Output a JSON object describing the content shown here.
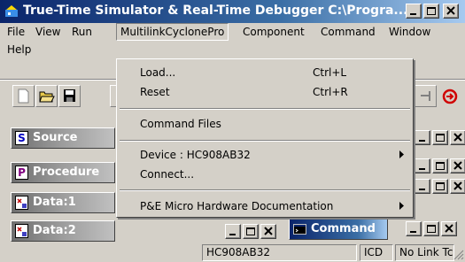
{
  "window": {
    "title": "True-Time Simulator & Real-Time Debugger  C:\\Progra..."
  },
  "menubar": {
    "items": [
      "File",
      "View",
      "Run",
      "MultilinkCyclonePro",
      "Component",
      "Command",
      "Window",
      "Help"
    ]
  },
  "dropdown": {
    "load": {
      "label": "Load...",
      "shortcut": "Ctrl+L"
    },
    "reset": {
      "label": "Reset",
      "shortcut": "Ctrl+R"
    },
    "command_files": {
      "label": "Command Files"
    },
    "device": {
      "label": "Device : HC908AB32"
    },
    "connect": {
      "label": "Connect..."
    },
    "pe_docs": {
      "label": "P&E Micro Hardware Documentation"
    }
  },
  "panels": {
    "source": {
      "title": "Source",
      "icon": "S"
    },
    "procedure": {
      "title": "Procedure",
      "icon": "P"
    },
    "data1": {
      "title": "Data:1"
    },
    "data2": {
      "title": "Data:2"
    },
    "command": {
      "title": "Command"
    }
  },
  "statusbar": {
    "device": "HC908AB32",
    "mode": "ICD",
    "link": "No Link Tc"
  },
  "colors": {
    "title_blue": "#0a246a",
    "face": "#d4d0c8"
  }
}
